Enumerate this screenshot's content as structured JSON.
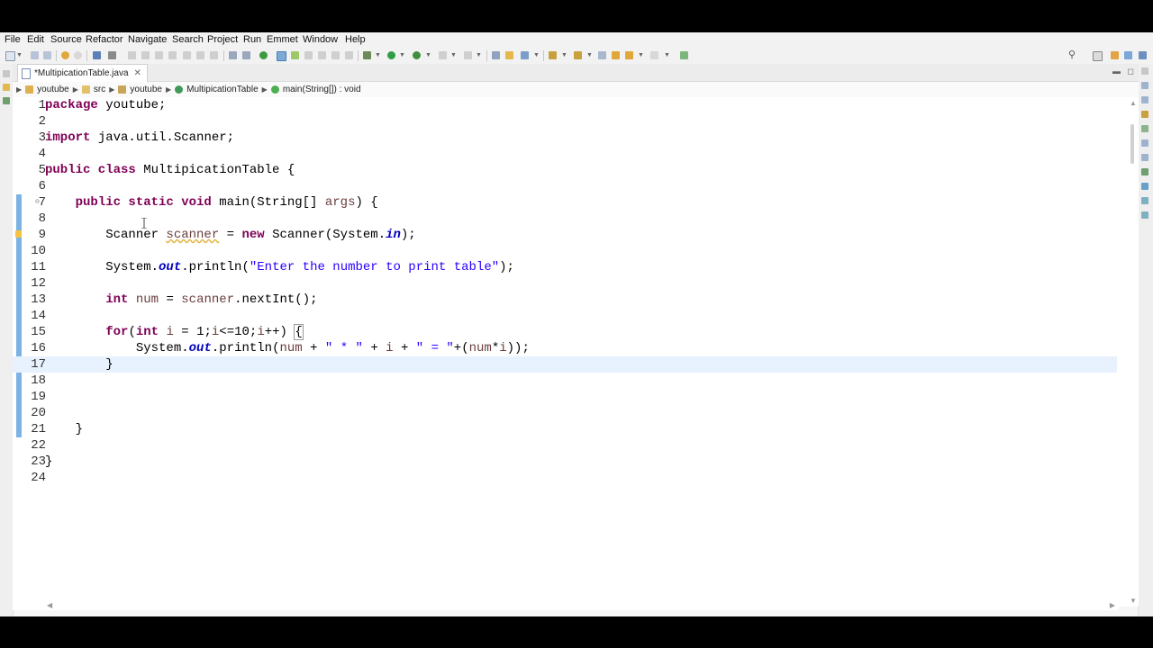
{
  "menu": [
    "File",
    "Edit",
    "Source",
    "Refactor",
    "Navigate",
    "Search",
    "Project",
    "Run",
    "Emmet",
    "Window",
    "Help"
  ],
  "tab": {
    "title": "*MultipicationTable.java",
    "close_icon": "close-icon"
  },
  "breadcrumb": {
    "project": "youtube",
    "folder": "src",
    "package": "youtube",
    "class": "MultipicationTable",
    "method": "main(String[]) : void"
  },
  "editor": {
    "current_line": 17,
    "line_numbers": [
      "1",
      "2",
      "3",
      "4",
      "5",
      "6",
      "7",
      "8",
      "9",
      "10",
      "11",
      "12",
      "13",
      "14",
      "15",
      "16",
      "17",
      "18",
      "19",
      "20",
      "21",
      "22",
      "23",
      "24"
    ]
  },
  "colors": {
    "keyword": "#7f0055",
    "string": "#2a00ff",
    "local_variable": "#6a3e3e",
    "static_field": "#0000c0",
    "change_bar": "#7db3e4",
    "current_line": "#e8f2fe"
  }
}
